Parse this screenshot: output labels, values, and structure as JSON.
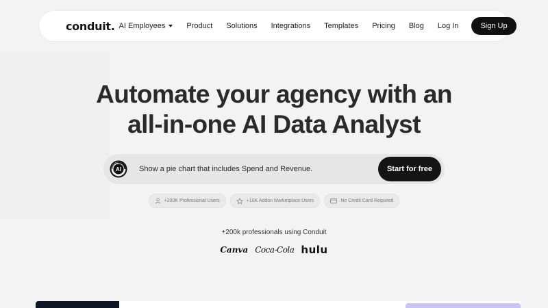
{
  "nav": {
    "logo": "conduit.",
    "links": [
      {
        "label": "AI Employees",
        "dropdown": true
      },
      {
        "label": "Product"
      },
      {
        "label": "Solutions"
      },
      {
        "label": "Integrations"
      },
      {
        "label": "Templates"
      },
      {
        "label": "Pricing"
      },
      {
        "label": "Blog"
      }
    ],
    "login": "Log In",
    "signup": "Sign Up"
  },
  "hero": {
    "title_line1": "Automate your agency with an",
    "title_line2": "all-in-one AI Data Analyst",
    "prompt_icon": "ai-logo-icon",
    "prompt_text": "Show a pie chart that includes Spend and Revenue.",
    "cta": "Start for free"
  },
  "badges": [
    {
      "icon": "user-icon",
      "label": "+200K Professional Users"
    },
    {
      "icon": "star-icon",
      "label": "+10K Addon Marketplace Users"
    },
    {
      "icon": "credit-card-icon",
      "label": "No Credit Card Required"
    }
  ],
  "social_proof": {
    "text": "+200k professionals using Conduit",
    "brands": [
      "Canva",
      "Coca-Cola",
      "hulu"
    ]
  },
  "colors": {
    "background": "#f3f3f3",
    "primary_dark": "#111111",
    "accent_purple": "#c9c4f4"
  }
}
